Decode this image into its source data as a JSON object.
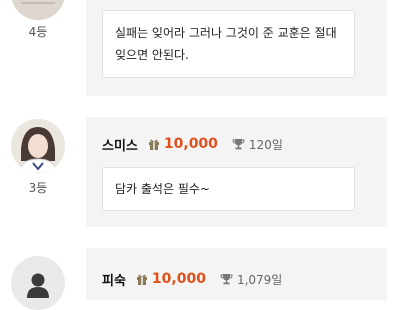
{
  "comments": [
    {
      "rank": "4등",
      "name": "",
      "points": "",
      "attendance": "",
      "message": "실패는 잊어라 그러나 그것이 준 교훈은 절대 잊으면 안된다."
    },
    {
      "rank": "3등",
      "name": "스미스",
      "points": "10,000",
      "attendance": "120일",
      "message": "담카 출석은 필수~"
    },
    {
      "rank": "",
      "name": "피숙",
      "points": "10,000",
      "attendance": "1,079일",
      "message": ""
    }
  ],
  "colors": {
    "points": "#e0501b",
    "card_bg": "#f4f4f4"
  },
  "icons": [
    "gift-icon",
    "trophy-icon",
    "user-icon"
  ]
}
